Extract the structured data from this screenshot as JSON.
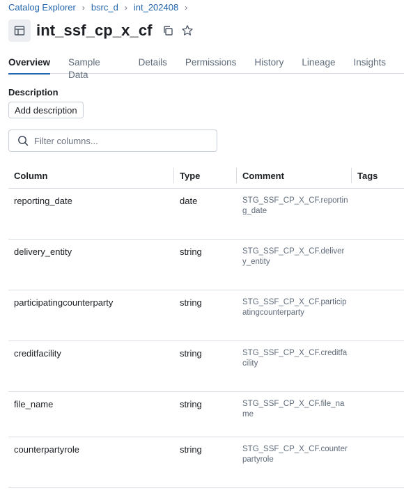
{
  "breadcrumb": {
    "items": [
      "Catalog Explorer",
      "bsrc_d",
      "int_202408"
    ]
  },
  "header": {
    "title": "int_ssf_cp_x_cf"
  },
  "tabs": [
    "Overview",
    "Sample Data",
    "Details",
    "Permissions",
    "History",
    "Lineage",
    "Insights"
  ],
  "active_tab": "Overview",
  "description": {
    "label": "Description",
    "button": "Add description"
  },
  "filter": {
    "placeholder": "Filter columns..."
  },
  "table": {
    "headers": {
      "column": "Column",
      "type": "Type",
      "comment": "Comment",
      "tags": "Tags"
    },
    "rows": [
      {
        "name": "reporting_date",
        "type": "date",
        "comment": "STG_SSF_CP_X_CF.reporting_date"
      },
      {
        "name": "delivery_entity",
        "type": "string",
        "comment": "STG_SSF_CP_X_CF.delivery_entity"
      },
      {
        "name": "participatingcounterparty",
        "type": "string",
        "comment": "STG_SSF_CP_X_CF.participatingcounterparty"
      },
      {
        "name": "creditfacility",
        "type": "string",
        "comment": "STG_SSF_CP_X_CF.creditfacility"
      },
      {
        "name": "file_name",
        "type": "string",
        "comment": "STG_SSF_CP_X_CF.file_name"
      },
      {
        "name": "counterpartyrole",
        "type": "string",
        "comment": "STG_SSF_CP_X_CF.counterpartyrole"
      }
    ]
  },
  "colors": {
    "accent": "#2266b0",
    "text": "#1b1f24",
    "muted": "#5f6b7a",
    "border": "#d8dde3"
  }
}
